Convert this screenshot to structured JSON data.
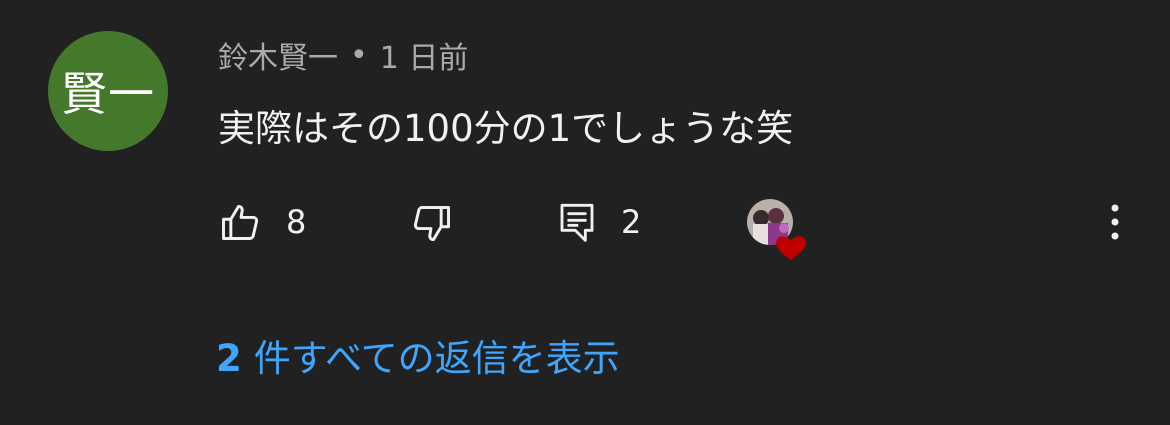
{
  "comment": {
    "avatar_initials": "賢一",
    "avatar_color": "#44792b",
    "author": "鈴木賢一",
    "separator": "•",
    "time": "1 日前",
    "text": "実際はその100分の1でしょうな笑"
  },
  "actions": {
    "like_icon": "thumbs-up-icon",
    "like_count": "8",
    "dislike_icon": "thumbs-down-icon",
    "reply_icon": "reply-icon",
    "reply_count": "2",
    "creator_heart_icon": "heart-icon",
    "more_icon": "more-vert-icon"
  },
  "replies": {
    "count": "2",
    "label": "件すべての返信を表示",
    "color": "#3ea6ff"
  },
  "theme": {
    "background": "#212121",
    "text_primary": "#f1f1f1",
    "text_secondary": "#aaaaaa",
    "heart_color": "#c00000"
  }
}
